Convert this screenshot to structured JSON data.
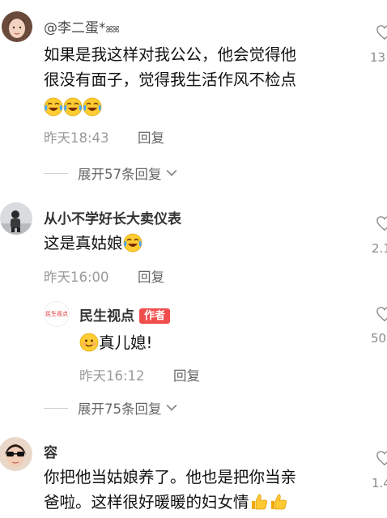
{
  "comments": [
    {
      "username": "@李二蛋*",
      "username_suffix": "ꕤꕤ",
      "text_line1": "如果是我这样对我公公，他会觉得他",
      "text_line2": "很没有面子，觉得我生活作风不检点",
      "time": "昨天18:43",
      "reply_label": "回复",
      "likes": "13",
      "expand_label": "展开57条回复"
    },
    {
      "username": "从小不学好长大卖仪表",
      "text": "这是真姑娘",
      "time": "昨天16:00",
      "reply_label": "回复",
      "likes": "2.1",
      "sub_reply": {
        "username": "民生视点",
        "avatar_text": "民生视点",
        "author_tag": "作者",
        "text": "真儿媳!",
        "time": "昨天16:12",
        "reply_label": "回复",
        "likes": "50"
      },
      "expand_label": "展开75条回复"
    },
    {
      "username": "容",
      "text_line1": "你把他当姑娘养了。他也是把你当亲",
      "text_line2": "爸啦。这样很好暖暖的妇女情",
      "likes": "1.4"
    }
  ],
  "icons": {
    "like": "heart-outline-icon",
    "expand": "chevron-down-icon",
    "laugh_emoji": "tears-of-joy-emoji",
    "smile_emoji": "smile-emoji",
    "thumbs_emoji": "thumbs-up-emoji"
  },
  "colors": {
    "author_tag": "#f24d4d",
    "meta_text": "#9a9a9a"
  }
}
